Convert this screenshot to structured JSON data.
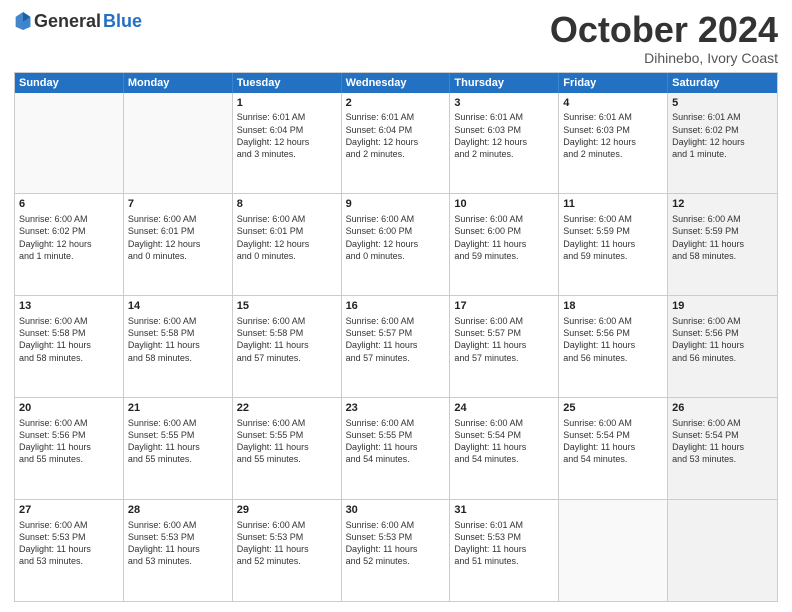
{
  "header": {
    "logo_general": "General",
    "logo_blue": "Blue",
    "month": "October 2024",
    "location": "Dihinebo, Ivory Coast"
  },
  "days_of_week": [
    "Sunday",
    "Monday",
    "Tuesday",
    "Wednesday",
    "Thursday",
    "Friday",
    "Saturday"
  ],
  "rows": [
    [
      {
        "day": "",
        "empty": true
      },
      {
        "day": "",
        "empty": true
      },
      {
        "day": "1",
        "lines": [
          "Sunrise: 6:01 AM",
          "Sunset: 6:04 PM",
          "Daylight: 12 hours",
          "and 3 minutes."
        ]
      },
      {
        "day": "2",
        "lines": [
          "Sunrise: 6:01 AM",
          "Sunset: 6:04 PM",
          "Daylight: 12 hours",
          "and 2 minutes."
        ]
      },
      {
        "day": "3",
        "lines": [
          "Sunrise: 6:01 AM",
          "Sunset: 6:03 PM",
          "Daylight: 12 hours",
          "and 2 minutes."
        ]
      },
      {
        "day": "4",
        "lines": [
          "Sunrise: 6:01 AM",
          "Sunset: 6:03 PM",
          "Daylight: 12 hours",
          "and 2 minutes."
        ]
      },
      {
        "day": "5",
        "shaded": true,
        "lines": [
          "Sunrise: 6:01 AM",
          "Sunset: 6:02 PM",
          "Daylight: 12 hours",
          "and 1 minute."
        ]
      }
    ],
    [
      {
        "day": "6",
        "lines": [
          "Sunrise: 6:00 AM",
          "Sunset: 6:02 PM",
          "Daylight: 12 hours",
          "and 1 minute."
        ]
      },
      {
        "day": "7",
        "lines": [
          "Sunrise: 6:00 AM",
          "Sunset: 6:01 PM",
          "Daylight: 12 hours",
          "and 0 minutes."
        ]
      },
      {
        "day": "8",
        "lines": [
          "Sunrise: 6:00 AM",
          "Sunset: 6:01 PM",
          "Daylight: 12 hours",
          "and 0 minutes."
        ]
      },
      {
        "day": "9",
        "lines": [
          "Sunrise: 6:00 AM",
          "Sunset: 6:00 PM",
          "Daylight: 12 hours",
          "and 0 minutes."
        ]
      },
      {
        "day": "10",
        "lines": [
          "Sunrise: 6:00 AM",
          "Sunset: 6:00 PM",
          "Daylight: 11 hours",
          "and 59 minutes."
        ]
      },
      {
        "day": "11",
        "lines": [
          "Sunrise: 6:00 AM",
          "Sunset: 5:59 PM",
          "Daylight: 11 hours",
          "and 59 minutes."
        ]
      },
      {
        "day": "12",
        "shaded": true,
        "lines": [
          "Sunrise: 6:00 AM",
          "Sunset: 5:59 PM",
          "Daylight: 11 hours",
          "and 58 minutes."
        ]
      }
    ],
    [
      {
        "day": "13",
        "lines": [
          "Sunrise: 6:00 AM",
          "Sunset: 5:58 PM",
          "Daylight: 11 hours",
          "and 58 minutes."
        ]
      },
      {
        "day": "14",
        "lines": [
          "Sunrise: 6:00 AM",
          "Sunset: 5:58 PM",
          "Daylight: 11 hours",
          "and 58 minutes."
        ]
      },
      {
        "day": "15",
        "lines": [
          "Sunrise: 6:00 AM",
          "Sunset: 5:58 PM",
          "Daylight: 11 hours",
          "and 57 minutes."
        ]
      },
      {
        "day": "16",
        "lines": [
          "Sunrise: 6:00 AM",
          "Sunset: 5:57 PM",
          "Daylight: 11 hours",
          "and 57 minutes."
        ]
      },
      {
        "day": "17",
        "lines": [
          "Sunrise: 6:00 AM",
          "Sunset: 5:57 PM",
          "Daylight: 11 hours",
          "and 57 minutes."
        ]
      },
      {
        "day": "18",
        "lines": [
          "Sunrise: 6:00 AM",
          "Sunset: 5:56 PM",
          "Daylight: 11 hours",
          "and 56 minutes."
        ]
      },
      {
        "day": "19",
        "shaded": true,
        "lines": [
          "Sunrise: 6:00 AM",
          "Sunset: 5:56 PM",
          "Daylight: 11 hours",
          "and 56 minutes."
        ]
      }
    ],
    [
      {
        "day": "20",
        "lines": [
          "Sunrise: 6:00 AM",
          "Sunset: 5:56 PM",
          "Daylight: 11 hours",
          "and 55 minutes."
        ]
      },
      {
        "day": "21",
        "lines": [
          "Sunrise: 6:00 AM",
          "Sunset: 5:55 PM",
          "Daylight: 11 hours",
          "and 55 minutes."
        ]
      },
      {
        "day": "22",
        "lines": [
          "Sunrise: 6:00 AM",
          "Sunset: 5:55 PM",
          "Daylight: 11 hours",
          "and 55 minutes."
        ]
      },
      {
        "day": "23",
        "lines": [
          "Sunrise: 6:00 AM",
          "Sunset: 5:55 PM",
          "Daylight: 11 hours",
          "and 54 minutes."
        ]
      },
      {
        "day": "24",
        "lines": [
          "Sunrise: 6:00 AM",
          "Sunset: 5:54 PM",
          "Daylight: 11 hours",
          "and 54 minutes."
        ]
      },
      {
        "day": "25",
        "lines": [
          "Sunrise: 6:00 AM",
          "Sunset: 5:54 PM",
          "Daylight: 11 hours",
          "and 54 minutes."
        ]
      },
      {
        "day": "26",
        "shaded": true,
        "lines": [
          "Sunrise: 6:00 AM",
          "Sunset: 5:54 PM",
          "Daylight: 11 hours",
          "and 53 minutes."
        ]
      }
    ],
    [
      {
        "day": "27",
        "lines": [
          "Sunrise: 6:00 AM",
          "Sunset: 5:53 PM",
          "Daylight: 11 hours",
          "and 53 minutes."
        ]
      },
      {
        "day": "28",
        "lines": [
          "Sunrise: 6:00 AM",
          "Sunset: 5:53 PM",
          "Daylight: 11 hours",
          "and 53 minutes."
        ]
      },
      {
        "day": "29",
        "lines": [
          "Sunrise: 6:00 AM",
          "Sunset: 5:53 PM",
          "Daylight: 11 hours",
          "and 52 minutes."
        ]
      },
      {
        "day": "30",
        "lines": [
          "Sunrise: 6:00 AM",
          "Sunset: 5:53 PM",
          "Daylight: 11 hours",
          "and 52 minutes."
        ]
      },
      {
        "day": "31",
        "lines": [
          "Sunrise: 6:01 AM",
          "Sunset: 5:53 PM",
          "Daylight: 11 hours",
          "and 51 minutes."
        ]
      },
      {
        "day": "",
        "empty": true
      },
      {
        "day": "",
        "empty": true,
        "shaded": true
      }
    ]
  ]
}
